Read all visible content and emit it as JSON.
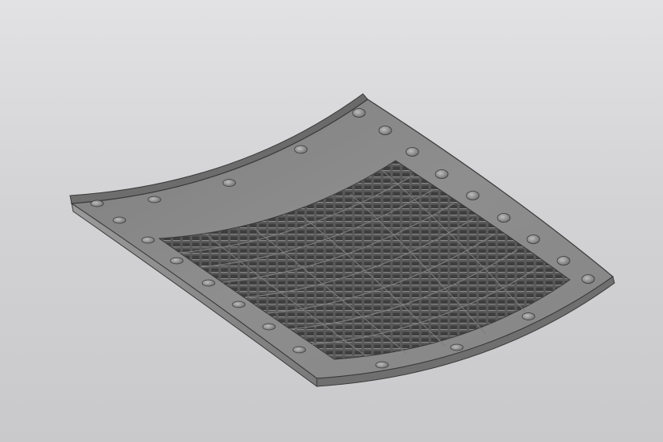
{
  "viewport": {
    "background_top": "#e2e2e4",
    "background_bottom": "#c9c9cb"
  },
  "model": {
    "part_name": "",
    "surface_color": "#8a8a8a",
    "edge_color": "#3a3a3a",
    "mesh_color": "#4a4a4a"
  }
}
